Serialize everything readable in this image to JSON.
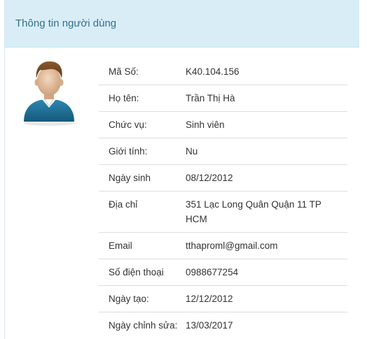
{
  "panel": {
    "title": "Thông tin người dùng"
  },
  "avatar": {
    "icon": "user-avatar-icon",
    "hair_color": "#7a4a22",
    "shirt_color": "#1f6f95",
    "skin_color": "#e6c3a3"
  },
  "fields": [
    {
      "label": "Mã Số:",
      "value": "K40.104.156"
    },
    {
      "label": "Họ tên:",
      "value": "Trần Thị Hà"
    },
    {
      "label": "Chức vụ:",
      "value": "Sinh viên"
    },
    {
      "label": "Giới tính:",
      "value": "Nu"
    },
    {
      "label": "Ngày sinh",
      "value": "08/12/2012"
    },
    {
      "label": "Địa chỉ",
      "value": "351 Lạc Long Quân Quận 11 TP HCM"
    },
    {
      "label": "Email",
      "value": "tthaproml@gmail.com"
    },
    {
      "label": "Số điện thoại",
      "value": "0988677254"
    },
    {
      "label": "Ngày tạo:",
      "value": "12/12/2012"
    },
    {
      "label": "Ngày chỉnh sửa:",
      "value": "13/03/2017"
    }
  ]
}
